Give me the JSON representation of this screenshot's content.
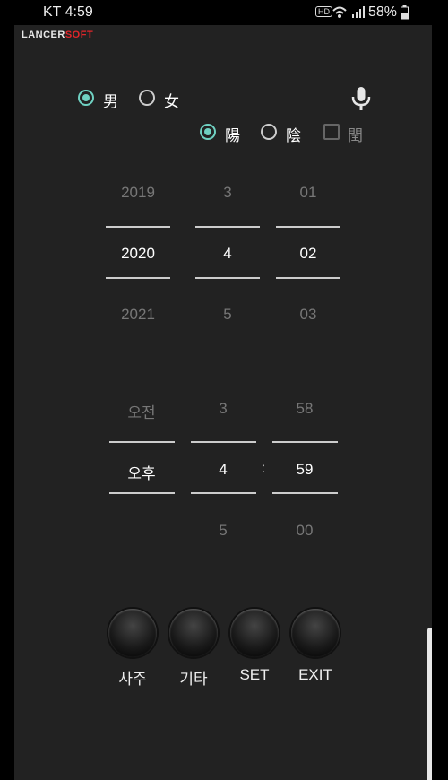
{
  "status": {
    "carrier_time": "KT 4:59",
    "hd": "HD",
    "battery": "58%"
  },
  "brand": {
    "part1": "LANCER",
    "part2": "SOFT",
    "color1": "#e8e8e8",
    "color2": "#e0262a"
  },
  "gender": {
    "male": "男",
    "female": "女",
    "selected": "male"
  },
  "calendar": {
    "solar": "陽",
    "lunar": "陰",
    "leap": "閏",
    "selected": "solar"
  },
  "date": {
    "year": {
      "prev": "2019",
      "cur": "2020",
      "next": "2021"
    },
    "month": {
      "prev": "3",
      "cur": "4",
      "next": "5"
    },
    "day": {
      "prev": "01",
      "cur": "02",
      "next": "03"
    }
  },
  "time": {
    "ampm": {
      "prev": "오전",
      "cur": "오후"
    },
    "hour": {
      "prev": "3",
      "cur": "4",
      "next": "5"
    },
    "separator": ":",
    "minute": {
      "prev": "58",
      "cur": "59",
      "next": "00"
    }
  },
  "buttons": {
    "saju": "사주",
    "etc": "기타",
    "set": "SET",
    "exit": "EXIT"
  },
  "accent_color": "#6fd1c2"
}
